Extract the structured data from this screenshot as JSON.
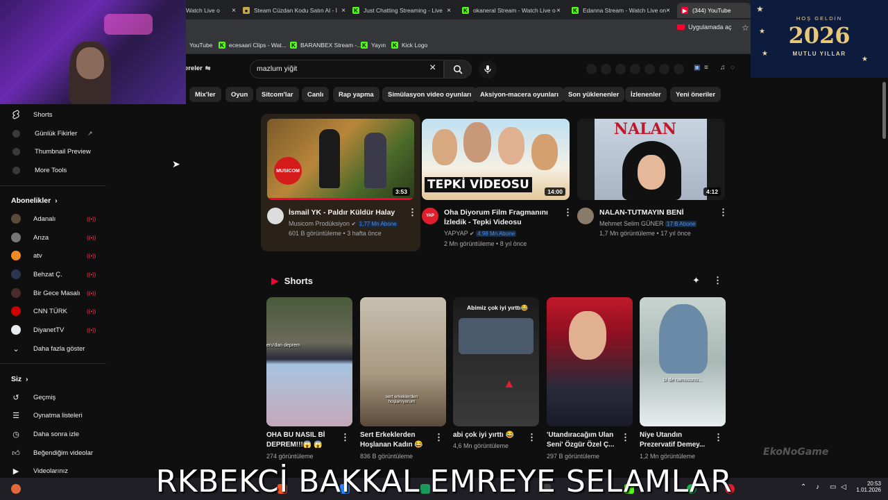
{
  "browser": {
    "tabs": [
      {
        "label": "Watch Live o",
        "favicon": "kick",
        "active": false
      },
      {
        "label": "Steam Cüzdan Kodu Satın Al - İ",
        "favicon": "steam",
        "active": false
      },
      {
        "label": "Just Chatting Streaming - Live",
        "favicon": "kick",
        "active": false
      },
      {
        "label": "okaneral Stream - Watch Live o",
        "favicon": "kick",
        "active": false
      },
      {
        "label": "Edanna Stream - Watch Live on",
        "favicon": "kick",
        "active": false
      },
      {
        "label": "(344) YouTube",
        "favicon": "youtube",
        "active": true
      }
    ],
    "open_in_app": "Uygulamada aç",
    "bookmarks": [
      {
        "label": "YouTube",
        "favicon": "none"
      },
      {
        "label": "ecesaari Clips - Wat...",
        "favicon": "kick"
      },
      {
        "label": "BARANBEX Stream -...",
        "favicon": "kick"
      },
      {
        "label": "Yayın",
        "favicon": "kick"
      },
      {
        "label": "Kick Logo",
        "favicon": "kick"
      }
    ]
  },
  "youtube": {
    "filter_label": "ereler",
    "search_value": "mazlum yiğit",
    "chips": [
      "Mix'ler",
      "Oyun",
      "Sitcom'lar",
      "Canlı",
      "Rap yapma",
      "Simülasyon video oyunları",
      "Aksiyon-macera oyunları",
      "Son yüklenenler",
      "İzlenenler",
      "Yeni öneriler"
    ],
    "sidebar": {
      "top_items": [
        {
          "label": "Shorts",
          "icon": "shorts-icon"
        },
        {
          "label": "Günlük Fikirler",
          "icon": "extension-icon",
          "external": "↗"
        },
        {
          "label": "Thumbnail Preview",
          "icon": "extension-icon"
        },
        {
          "label": "More Tools",
          "icon": "extension-icon"
        }
      ],
      "subscriptions_title": "Abonelikler",
      "subscriptions": [
        {
          "label": "Adanalı",
          "color": "#5a4a3a"
        },
        {
          "label": "Arıza",
          "color": "#777777"
        },
        {
          "label": "atv",
          "color": "#f08a24"
        },
        {
          "label": "Behzat Ç.",
          "color": "#2b3550"
        },
        {
          "label": "Bir Gece Masalı",
          "color": "#4a2a2a"
        },
        {
          "label": "CNN TÜRK",
          "color": "#cc0000"
        },
        {
          "label": "DiyanetTV",
          "color": "#e8eef0"
        }
      ],
      "show_more": "Daha fazla göster",
      "you_title": "Siz",
      "you_items": [
        {
          "label": "Geçmiş",
          "icon": "history-icon"
        },
        {
          "label": "Oynatma listeleri",
          "icon": "playlist-icon"
        },
        {
          "label": "Daha sonra izle",
          "icon": "watch-later-icon"
        },
        {
          "label": "Beğendiğim videolar",
          "icon": "like-icon"
        },
        {
          "label": "Videolarınız",
          "icon": "your-videos-icon"
        }
      ]
    },
    "videos": [
      {
        "title": "İsmail YK - Paldır Küldür Halay",
        "channel": "Musicom Prodüksiyon",
        "verified": true,
        "subs": "1,77 Mn Abone",
        "stats": "601 B görüntüleme • 3 hafta önce",
        "duration": "3:53",
        "thumb_text": "MUSICOM"
      },
      {
        "title": "Oha Diyorum Film Fragmanını İzledik - Tepki Videosu",
        "channel": "YAPYAP",
        "verified": true,
        "subs": "4,98 Mn Abone",
        "stats": "2 Mn görüntüleme • 8 yıl önce",
        "duration": "14:00",
        "thumb_text": "TEPKİ VİDEOSU"
      },
      {
        "title": "NALAN-TUTMAYIN BENİ",
        "channel": "Mehmet Selim GÜNER",
        "verified": false,
        "subs": "17 B Abone",
        "stats": "1,7 Mn görüntüleme • 17 yıl önce",
        "duration": "4:12",
        "thumb_text": "NALAN"
      }
    ],
    "shorts_title": "Shorts",
    "shorts": [
      {
        "title": "OHA BU NASIL Bİ DEPREM!!!😱 😱",
        "views": "274 görüntüleme",
        "overlay": "eru'dan deprem"
      },
      {
        "title": "Sert Erkeklerden Hoşlanan Kadın 😂",
        "views": "836 B görüntüleme",
        "overlay": "sert erkeklerden hoşlanıyorum"
      },
      {
        "title": "abi çok iyi yırttı 😂",
        "views": "4,6 Mn görüntüleme",
        "overlay": "Abimiz çok iyi yırttı😂"
      },
      {
        "title": "'Utandıracağım Ulan Seni' Özgür Özel Ç...",
        "views": "297 B görüntüleme",
        "overlay": ""
      },
      {
        "title": "Niye Utandın Prezervatif Demey...",
        "views": "1,2 Mn görüntüleme",
        "overlay": "bi de namusunu..."
      }
    ]
  },
  "overlay": {
    "greeting": "HOŞ GELDİN",
    "year": "2026",
    "wishes": "MUTLU YILLAR",
    "caption": "RKBEKCİ BAKKAL EMREYE SELAMLAR",
    "watermark": "EkoNoGame"
  },
  "taskbar": {
    "time": "20:53",
    "date": "1.01.2026"
  }
}
